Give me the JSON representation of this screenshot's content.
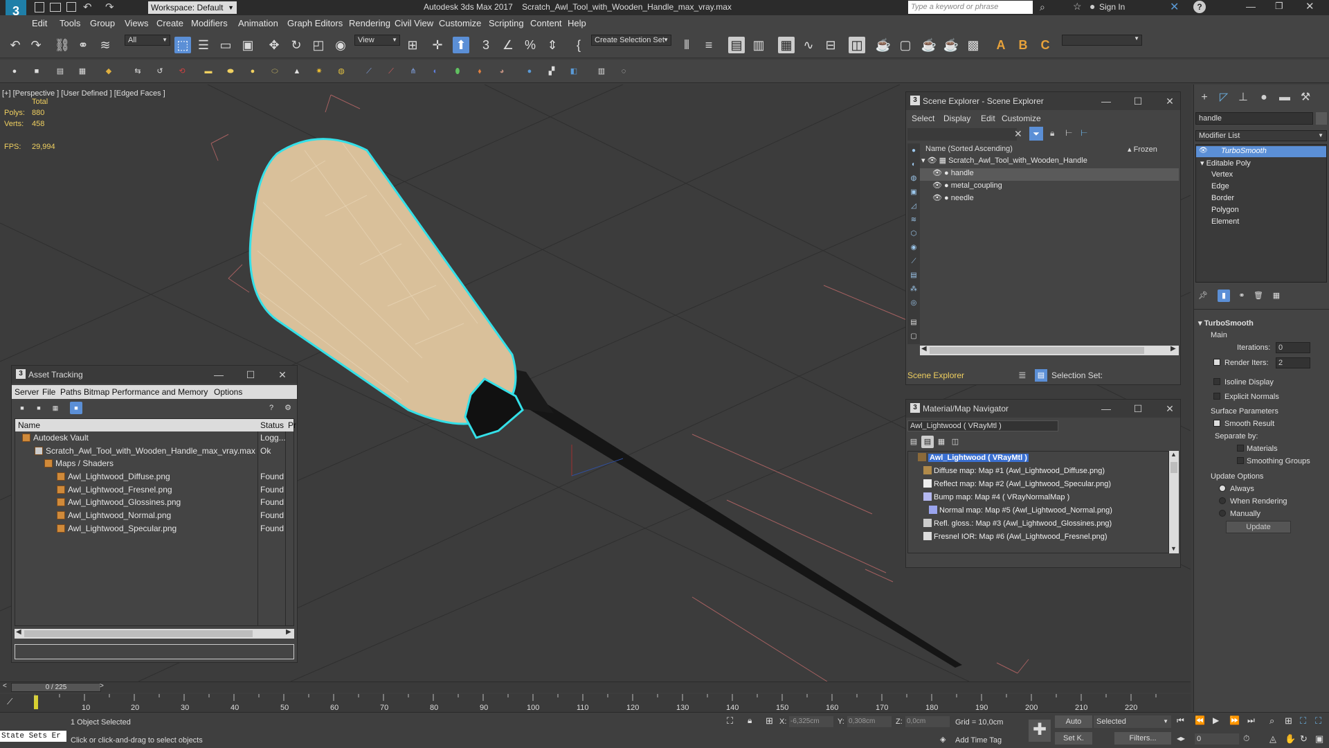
{
  "app": {
    "title": "Autodesk 3ds Max 2017",
    "file": "Scratch_Awl_Tool_with_Wooden_Handle_max_vray.max",
    "workspace": "Workspace: Default",
    "search_placeholder": "Type a keyword or phrase",
    "sign_in": "Sign In"
  },
  "menu": [
    "Edit",
    "Tools",
    "Group",
    "Views",
    "Create",
    "Modifiers",
    "Animation",
    "Graph Editors",
    "Rendering",
    "Civil View",
    "Customize",
    "Scripting",
    "Content",
    "Help"
  ],
  "toolbar": {
    "filter": "All",
    "view_dropdown": "View",
    "selection_set": "Create Selection Set"
  },
  "viewport": {
    "label": "[+] [Perspective ] [User Defined ] [Edged Faces ]",
    "total": "Total",
    "polys_label": "Polys:",
    "polys": "880",
    "verts_label": "Verts:",
    "verts": "458",
    "fps_label": "FPS:",
    "fps": "29,994"
  },
  "asset_tracking": {
    "title": "Asset Tracking",
    "menu": [
      "Server",
      "File",
      "Paths",
      "Bitmap Performance and Memory",
      "Options"
    ],
    "columns": [
      "Name",
      "Status",
      "Pr"
    ],
    "rows": [
      {
        "name": "Autodesk Vault",
        "status": "Logg..."
      },
      {
        "name": "Scratch_Awl_Tool_with_Wooden_Handle_max_vray.max",
        "status": "Ok"
      },
      {
        "name": "Maps / Shaders",
        "status": ""
      },
      {
        "name": "Awl_Lightwood_Diffuse.png",
        "status": "Found"
      },
      {
        "name": "Awl_Lightwood_Fresnel.png",
        "status": "Found"
      },
      {
        "name": "Awl_Lightwood_Glossines.png",
        "status": "Found"
      },
      {
        "name": "Awl_Lightwood_Normal.png",
        "status": "Found"
      },
      {
        "name": "Awl_Lightwood_Specular.png",
        "status": "Found"
      }
    ]
  },
  "scene_explorer": {
    "title": "Scene Explorer - Scene Explorer",
    "menu": [
      "Select",
      "Display",
      "Edit",
      "Customize"
    ],
    "col_name": "Name (Sorted Ascending)",
    "col_frozen": "▴ Frozen",
    "root": "Scratch_Awl_Tool_with_Wooden_Handle",
    "children": [
      "handle",
      "metal_coupling",
      "needle"
    ],
    "footer_label": "Scene Explorer",
    "selection_set": "Selection Set:"
  },
  "material_navigator": {
    "title": "Material/Map Navigator",
    "current": "Awl_Lightwood  ( VRayMtl )",
    "root": "Awl_Lightwood  ( VRayMtl )",
    "maps": [
      "Diffuse map: Map #1 (Awl_Lightwood_Diffuse.png)",
      "Reflect map: Map #2 (Awl_Lightwood_Specular.png)",
      "Bump map: Map #4  ( VRayNormalMap )",
      "Normal map: Map #5 (Awl_Lightwood_Normal.png)",
      "Refl. gloss.: Map #3 (Awl_Lightwood_Glossines.png)",
      "Fresnel IOR: Map #6 (Awl_Lightwood_Fresnel.png)"
    ]
  },
  "command_panel": {
    "object_name": "handle",
    "modifier_list": "Modifier List",
    "stack": [
      "TurboSmooth",
      "Editable Poly",
      "Vertex",
      "Edge",
      "Border",
      "Polygon",
      "Element"
    ],
    "rollout": "TurboSmooth",
    "main": "Main",
    "iterations_label": "Iterations:",
    "iterations": "0",
    "render_iters_label": "Render Iters:",
    "render_iters": "2",
    "isoline": "Isoline Display",
    "explicit_normals": "Explicit Normals",
    "surface_params": "Surface Parameters",
    "smooth_result": "Smooth Result",
    "separate_by": "Separate by:",
    "materials": "Materials",
    "smoothing_groups": "Smoothing Groups",
    "update_options": "Update Options",
    "always": "Always",
    "when_rendering": "When Rendering",
    "manually": "Manually",
    "update_btn": "Update"
  },
  "timeline": {
    "frame": "0 / 225",
    "ticks": [
      "0",
      "10",
      "20",
      "30",
      "40",
      "50",
      "60",
      "70",
      "80",
      "90",
      "100",
      "110",
      "120",
      "130",
      "140",
      "150",
      "160",
      "170",
      "180",
      "190",
      "200",
      "210",
      "220"
    ]
  },
  "status": {
    "maxscript": "State Sets Er",
    "selected": "1 Object Selected",
    "prompt": "Click or click-and-drag to select objects",
    "x_label": "X:",
    "x": "-6,325cm",
    "y_label": "Y:",
    "y": "0,308cm",
    "z_label": "Z:",
    "z": "0,0cm",
    "grid": "Grid = 10,0cm",
    "add_time_tag": "Add Time Tag",
    "auto": "Auto",
    "set_k": "Set K.",
    "selected_dropdown": "Selected",
    "filters": "Filters...",
    "frame_value": "0"
  }
}
